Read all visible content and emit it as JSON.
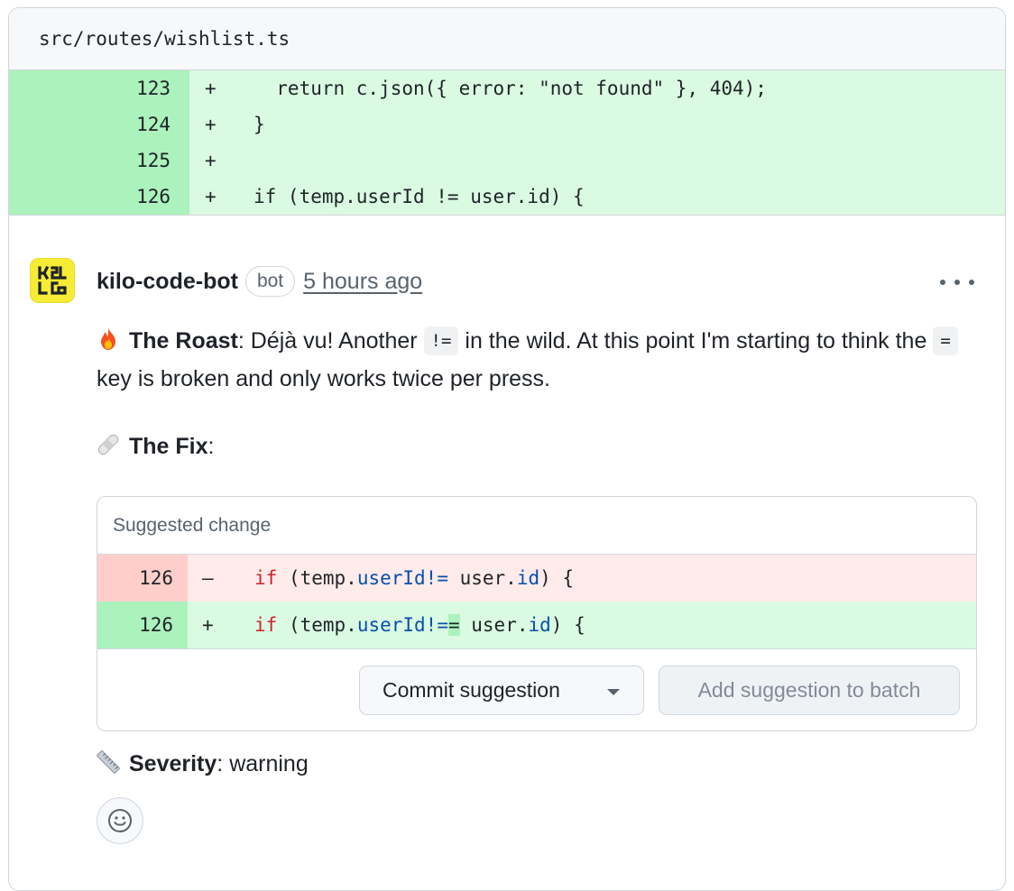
{
  "file": {
    "path": "src/routes/wishlist.ts"
  },
  "diff_lines": [
    {
      "num": "123",
      "sign": "+",
      "code": "  return c.json({ error: \"not found\" }, 404);"
    },
    {
      "num": "124",
      "sign": "+",
      "code": "}"
    },
    {
      "num": "125",
      "sign": "+",
      "code": ""
    },
    {
      "num": "126",
      "sign": "+",
      "code": "if (temp.userId != user.id) {"
    }
  ],
  "comment": {
    "author": "kilo-code-bot",
    "badge": "bot",
    "time": "5 hours ago",
    "avatar_icon": "kilo-logo-icon",
    "avatar_color": "#f7ec35",
    "roast_emoji": "fire-icon",
    "roast_label": "The Roast",
    "roast_text_1": ": Déjà vu! Another",
    "roast_code_1": "!=",
    "roast_text_2": "in the wild. At this point I'm starting to think the",
    "roast_code_2": "=",
    "roast_text_3": "key is broken and only works twice per press.",
    "fix_emoji": "bandage-icon",
    "fix_label": "The Fix",
    "fix_suffix": ":",
    "severity_emoji": "ruler-icon",
    "severity_label": "Severity",
    "severity_suffix": ": warning"
  },
  "suggestion": {
    "title": "Suggested change",
    "removed": {
      "num": "126",
      "sign": "–"
    },
    "added": {
      "num": "126",
      "sign": "+"
    },
    "commit_label": "Commit suggestion",
    "batch_label": "Add suggestion to batch"
  },
  "reaction": {
    "icon": "smiley-icon"
  },
  "colors": {
    "added_bg": "#dafbe1",
    "added_num_bg": "#abf2bc",
    "removed_bg": "#ffebe9",
    "removed_num_bg": "#ffcecb",
    "keyword": "#cf222e",
    "property": "#0550ae"
  }
}
